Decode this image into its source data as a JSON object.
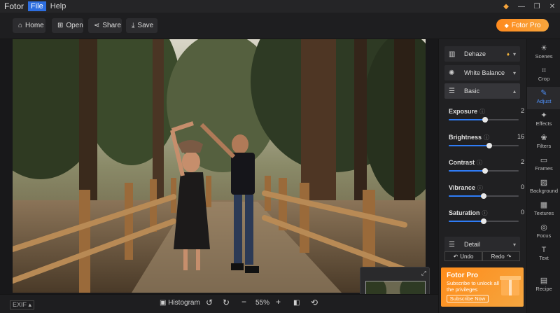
{
  "app": {
    "name": "Fotor"
  },
  "menu": [
    {
      "label": "File",
      "active": true
    },
    {
      "label": "Help",
      "active": false
    }
  ],
  "window_controls": {
    "diamond": "◆",
    "minimize": "—",
    "maximize": "❐",
    "close": "✕"
  },
  "toolbar": {
    "home": {
      "label": "Home",
      "icon": "⌂"
    },
    "open": {
      "label": "Open",
      "icon": "⊞"
    },
    "share": {
      "label": "Share",
      "icon": "⋖"
    },
    "save": {
      "label": "Save",
      "icon": "⤓"
    },
    "pro": {
      "label": "Fotor Pro",
      "icon": "◆"
    }
  },
  "statusbar": {
    "exif": "EXIF",
    "histogram": "Histogram",
    "zoom": "55%"
  },
  "panel": {
    "sections": {
      "dehaze": "Dehaze",
      "white_balance": "White Balance",
      "basic": "Basic",
      "detail": "Detail"
    },
    "sliders": [
      {
        "label": "Exposure",
        "value": "2",
        "fraction": 0.52
      },
      {
        "label": "Brightness",
        "value": "16",
        "fraction": 0.58
      },
      {
        "label": "Contrast",
        "value": "2",
        "fraction": 0.52
      },
      {
        "label": "Vibrance",
        "value": "0",
        "fraction": 0.5
      },
      {
        "label": "Saturation",
        "value": "0",
        "fraction": 0.5
      }
    ],
    "undo": "Undo",
    "redo": "Redo",
    "promo": {
      "title": "Fotor Pro",
      "subtitle": "Subscribe to unlock all the privileges",
      "cta": "Subscribe Now"
    }
  },
  "rail": [
    {
      "label": "Scenes",
      "icon": "☀",
      "active": false
    },
    {
      "label": "Crop",
      "icon": "⌗",
      "active": false
    },
    {
      "label": "Adjust",
      "icon": "✎",
      "active": true
    },
    {
      "label": "Effects",
      "icon": "✦",
      "active": false
    },
    {
      "label": "Filters",
      "icon": "❀",
      "active": false
    },
    {
      "label": "Frames",
      "icon": "▭",
      "active": false
    },
    {
      "label": "Background",
      "icon": "▨",
      "active": false
    },
    {
      "label": "Textures",
      "icon": "▦",
      "active": false
    },
    {
      "label": "Focus",
      "icon": "◎",
      "active": false
    },
    {
      "label": "Text",
      "icon": "T",
      "active": false
    },
    {
      "label": "Recipe",
      "icon": "▤",
      "active": false
    }
  ],
  "colors": {
    "accent": "#2f7cf6",
    "pro_orange": "#ff8a1d",
    "menu_active": "#2d6ee0"
  }
}
